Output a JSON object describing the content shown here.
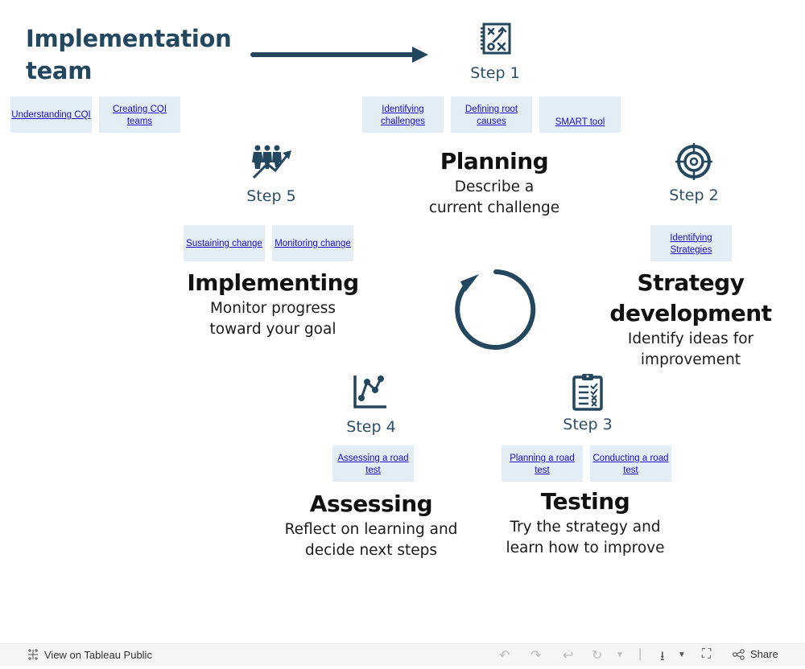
{
  "header": {
    "title_line1": "Implementation",
    "title_line2": "team",
    "links": [
      "Understanding CQI",
      "Creating CQI teams"
    ]
  },
  "colors": {
    "primary": "#23475f",
    "link_box": "#e2edf6",
    "link": "#1a0dcc"
  },
  "steps": {
    "step1": {
      "label": "Step 1",
      "icon": "strategy-board-icon",
      "links": [
        "Identifying challenges",
        "Defining root causes",
        "SMART tool"
      ],
      "title": "Planning",
      "desc_line1": "Describe a",
      "desc_line2": "current challenge"
    },
    "step2": {
      "label": "Step 2",
      "icon": "target-icon",
      "links": [
        "Identifying Strategies"
      ],
      "title_line1": "Strategy",
      "title_line2": "development",
      "desc_line1": "Identify ideas for",
      "desc_line2": "improvement"
    },
    "step3": {
      "label": "Step 3",
      "icon": "clipboard-checklist-icon",
      "links": [
        "Planning a road test",
        "Conducting a road test"
      ],
      "title": "Testing",
      "desc_line1": "Try the strategy and",
      "desc_line2": "learn how to improve"
    },
    "step4": {
      "label": "Step 4",
      "icon": "line-chart-icon",
      "links": [
        "Assessing a road test"
      ],
      "title": "Assessing",
      "desc_line1": "Reflect on learning and",
      "desc_line2": "decide next steps"
    },
    "step5": {
      "label": "Step 5",
      "icon": "people-growth-icon",
      "links": [
        "Sustaining change",
        "Monitoring change"
      ],
      "title": "Implementing",
      "desc_line1": "Monitor progress",
      "desc_line2": "toward your goal"
    }
  },
  "center_icon": "cycle-arrow-icon",
  "footer": {
    "view_link": "View on Tableau Public",
    "share_label": "Share"
  }
}
